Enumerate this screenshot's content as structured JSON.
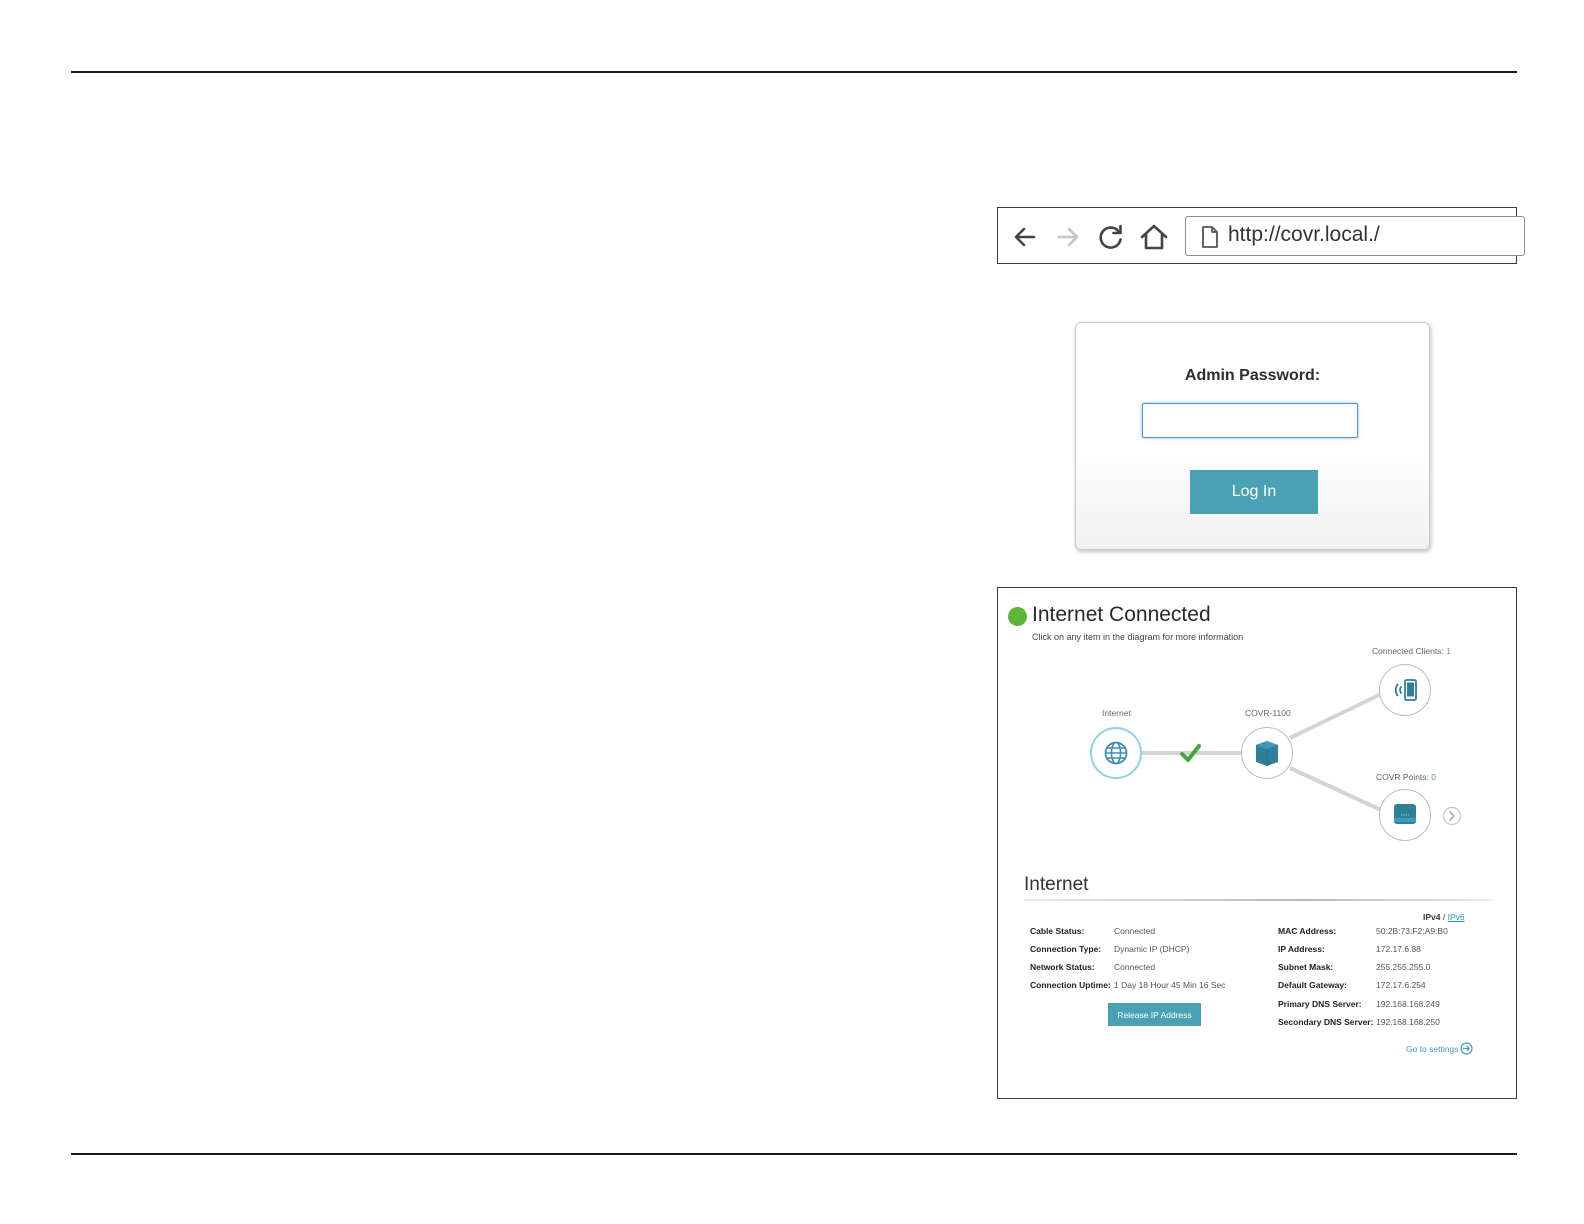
{
  "browser": {
    "url": "http://covr.local./",
    "icons": [
      "back-arrow-icon",
      "forward-arrow-icon",
      "reload-icon",
      "home-icon",
      "page-icon"
    ]
  },
  "login": {
    "label": "Admin Password:",
    "password_value": "",
    "button_label": "Log In"
  },
  "status": {
    "title": "Internet Connected",
    "hint": "Click on any item in the diagram for more information",
    "status_color": "#5db53a",
    "diagram": {
      "internet_label": "Internet",
      "router_label": "COVR-1100",
      "clients_label": "Connected Clients:",
      "clients_count": "1",
      "points_label": "COVR Points:",
      "points_count": "0"
    },
    "section_title": "Internet",
    "ip_v4": "IPv4",
    "ip_sep": "/",
    "ip_v6": "IPv6",
    "left_info": [
      {
        "key": "Cable Status:",
        "value": "Connected"
      },
      {
        "key": "Connection Type:",
        "value": "Dynamic IP (DHCP)"
      },
      {
        "key": "Network Status:",
        "value": "Connected"
      },
      {
        "key": "Connection Uptime:",
        "value": "1 Day 18 Hour 45 Min 16 Sec"
      }
    ],
    "right_info": [
      {
        "key": "MAC Address:",
        "value": "50:2B:73:F2:A9:B0"
      },
      {
        "key": "IP Address:",
        "value": "172.17.6.88"
      },
      {
        "key": "Subnet Mask:",
        "value": "255.255.255.0"
      },
      {
        "key": "Default Gateway:",
        "value": "172.17.6.254"
      },
      {
        "key": "Primary DNS Server:",
        "value": "192.168.168.249"
      },
      {
        "key": "Secondary DNS Server:",
        "value": "192.168.168.250"
      }
    ],
    "release_button": "Release IP Address",
    "go_settings": "Go to settings",
    "accent_color": "#4aa1b4"
  }
}
